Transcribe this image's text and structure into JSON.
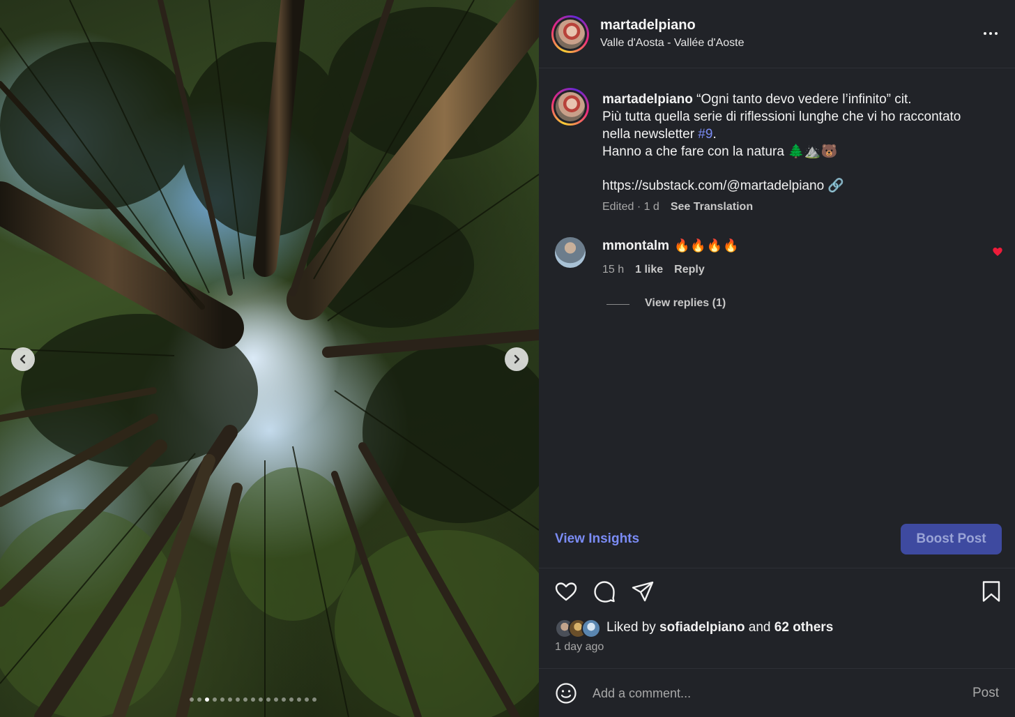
{
  "post": {
    "username": "martadelpiano",
    "location": "Valle d'Aosta - Vallée d'Aoste",
    "more_icon": "more-horizontal-icon",
    "caption": {
      "username": "martadelpiano",
      "line1": " “Ogni tanto devo vedere l’infinito” cit.",
      "line2": "Più tutta quella serie di riflessioni lunghe che vi ho raccontato",
      "line3_prefix": "nella newsletter ",
      "line3_hashtag": "#9",
      "line3_suffix": ".",
      "line4": "Hanno a che fare con la natura 🌲⛰️🐻",
      "line5": "https://substack.com/@martadelpiano 🔗",
      "edited": "Edited · 1 d",
      "see_translation": "See Translation"
    },
    "comment": {
      "username": "mmontalm",
      "text": "🔥🔥🔥🔥",
      "time": "15 h",
      "likes": "1 like",
      "reply": "Reply",
      "view_replies": "View replies (1)",
      "heart_color": "#ed1c3a"
    },
    "view_insights": "View Insights",
    "boost_post": "Boost Post",
    "liked_prefix": "Liked by ",
    "liked_user": "sofiadelpiano",
    "liked_mid": " and ",
    "liked_others": "62 others",
    "time_ago": "1 day ago",
    "add_comment_placeholder": "Add a comment...",
    "post_label": "Post"
  },
  "media": {
    "description_icons": [
      "chevron-left-icon",
      "chevron-right-icon"
    ],
    "carousel_dot_count": 17,
    "active_dot": 2
  },
  "colors": {
    "panel_bg": "#212328",
    "link": "#7b8cf5",
    "boost_bg": "#3e4aa0",
    "like_red": "#ed1c3a"
  }
}
